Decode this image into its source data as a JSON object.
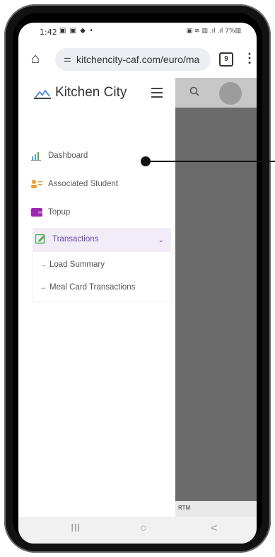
{
  "status_bar": {
    "time": "1:42",
    "left_icons": "▣ ▣ ◆ •",
    "right_icons": "▣ ≋ ▥ .ıl .ıl 7%▥"
  },
  "browser": {
    "url": "kitchencity-caf.com/euro/ma",
    "tab_count": "9"
  },
  "sidebar": {
    "brand": "Kitchen City",
    "items": [
      {
        "label": "Dashboard",
        "icon": "bar-chart-icon"
      },
      {
        "label": "Associated Student",
        "icon": "id-card-icon"
      },
      {
        "label": "Topup",
        "icon": "wallet-icon"
      },
      {
        "label": "Transactions",
        "icon": "edit-icon"
      }
    ],
    "sub_items": [
      {
        "label": "Load Summary"
      },
      {
        "label": "Meal Card Transactions"
      }
    ]
  },
  "overlay": {
    "footer_text": "RTM"
  },
  "nav_bar": {
    "recents": "III",
    "home": "○",
    "back": "<"
  },
  "colors": {
    "accent": "#6d4aa8",
    "overlay": "#6b6b6b"
  }
}
